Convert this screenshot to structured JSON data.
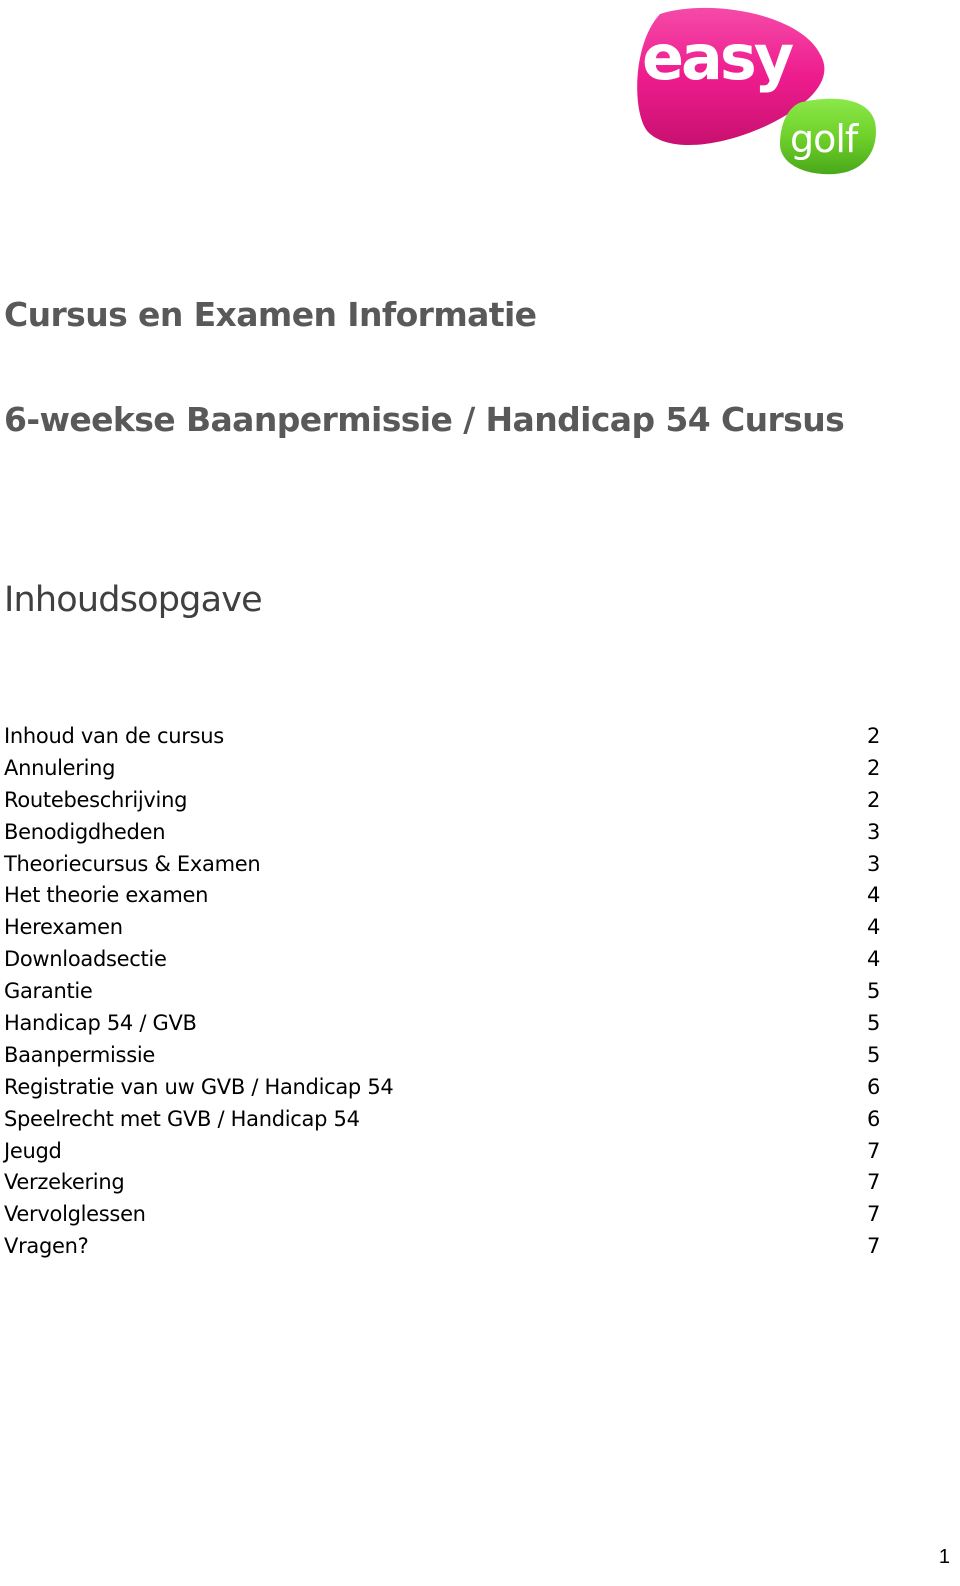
{
  "logo": {
    "word1": "easy",
    "word2": "golf",
    "colors": {
      "pink": "#ee1c8e",
      "pink_dark": "#c8106f",
      "green": "#6fd12a",
      "green_dark": "#4aa81a",
      "text": "#ffffff"
    }
  },
  "header": {
    "title": "Cursus en Examen Informatie",
    "subtitle": "6-weekse Baanpermissie / Handicap 54 Cursus"
  },
  "toc": {
    "heading": "Inhoudsopgave",
    "items": [
      {
        "label": "Inhoud van de cursus",
        "page": "2"
      },
      {
        "label": "Annulering",
        "page": "2"
      },
      {
        "label": "Routebeschrijving",
        "page": "2"
      },
      {
        "label": "Benodigdheden",
        "page": "3"
      },
      {
        "label": "Theoriecursus & Examen",
        "page": "3"
      },
      {
        "label": "Het theorie examen",
        "page": "4"
      },
      {
        "label": "Herexamen",
        "page": "4"
      },
      {
        "label": "Downloadsectie",
        "page": "4"
      },
      {
        "label": "Garantie",
        "page": "5"
      },
      {
        "label": "Handicap 54 / GVB",
        "page": "5"
      },
      {
        "label": "Baanpermissie",
        "page": "5"
      },
      {
        "label": "Registratie van uw GVB / Handicap 54",
        "page": "6"
      },
      {
        "label": "Speelrecht met GVB / Handicap 54",
        "page": "6"
      },
      {
        "label": "Jeugd",
        "page": "7"
      },
      {
        "label": "Verzekering",
        "page": "7"
      },
      {
        "label": "Vervolglessen",
        "page": "7"
      },
      {
        "label": "Vragen?",
        "page": "7"
      }
    ]
  },
  "footer": {
    "page_number": "1"
  }
}
